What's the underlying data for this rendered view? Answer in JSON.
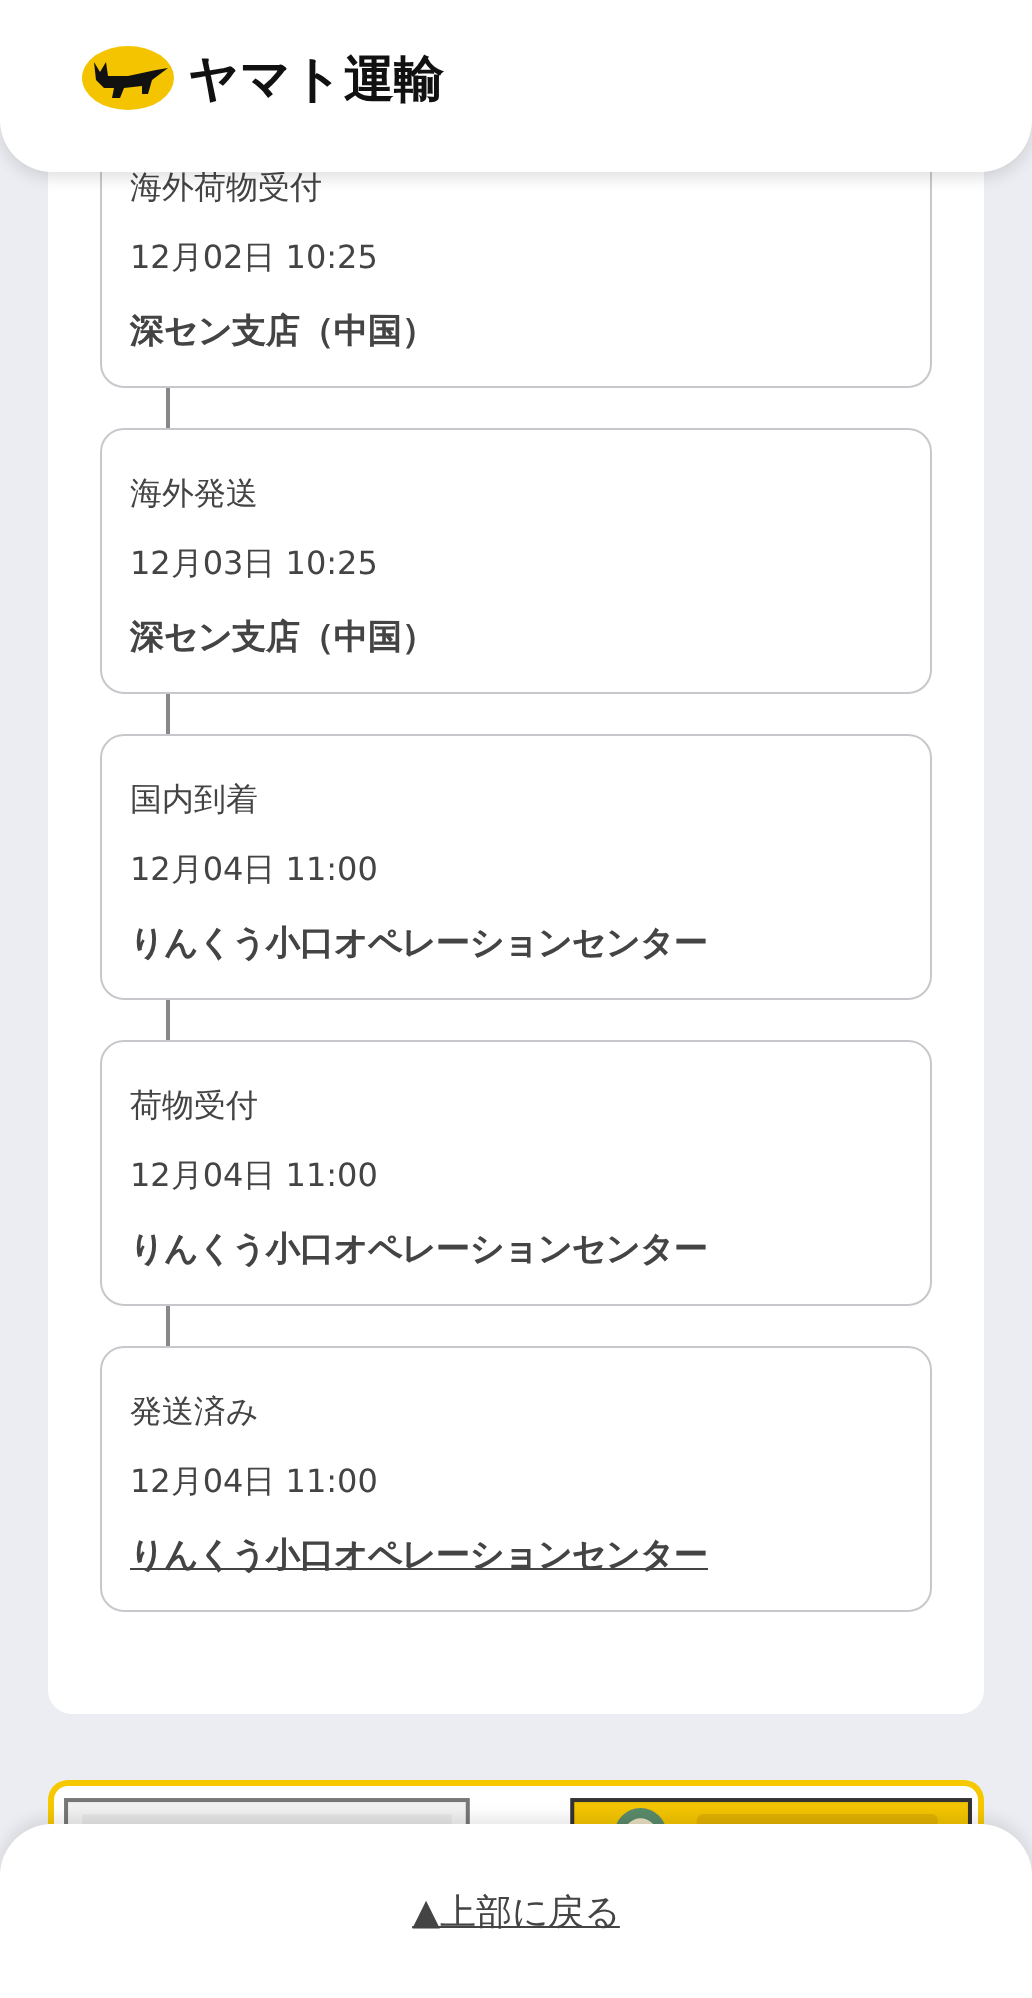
{
  "header": {
    "logo_text": "ヤマト運輸"
  },
  "events": [
    {
      "status": "海外荷物受付",
      "datetime": "12月02日 10:25",
      "location": "深セン支店（中国）",
      "linked": false
    },
    {
      "status": "海外発送",
      "datetime": "12月03日 10:25",
      "location": "深セン支店（中国）",
      "linked": false
    },
    {
      "status": "国内到着",
      "datetime": "12月04日 11:00",
      "location": "りんくう小口オペレーションセンター",
      "linked": false
    },
    {
      "status": "荷物受付",
      "datetime": "12月04日 11:00",
      "location": "りんくう小口オペレーションセンター",
      "linked": false
    },
    {
      "status": "発送済み",
      "datetime": "12月04日 11:00",
      "location": "りんくう小口オペレーションセンター",
      "linked": true
    }
  ],
  "footer": {
    "back_to_top": "▲上部に戻る"
  }
}
